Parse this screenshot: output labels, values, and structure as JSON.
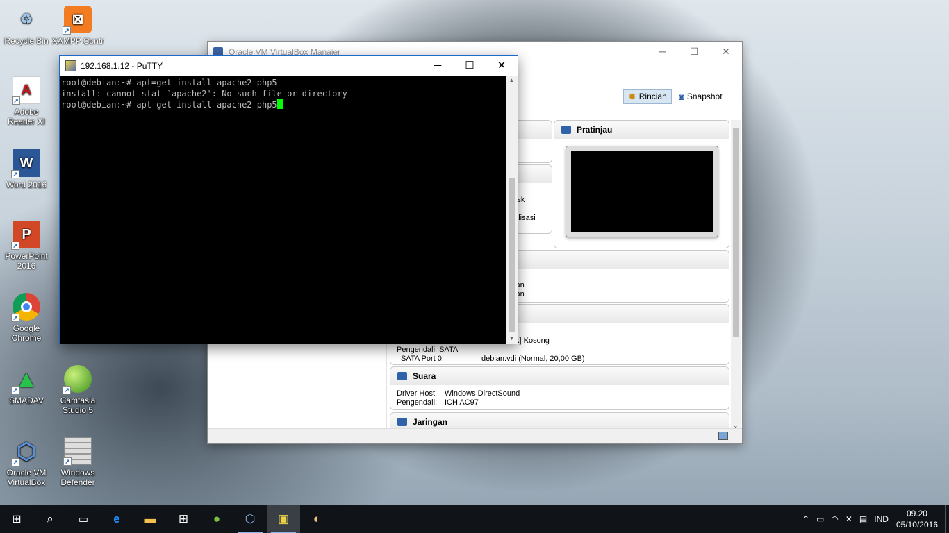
{
  "desktop_icons": [
    {
      "label": "Recycle Bin",
      "icon": "recycle-bin-icon"
    },
    {
      "label": "XAMPP Contr",
      "icon": "xampp-icon"
    },
    {
      "label": "Adobe Reader XI",
      "icon": "adobe-reader-icon"
    },
    {
      "label": "Word 2016",
      "icon": "word-icon"
    },
    {
      "label": "PowerPoint 2016",
      "icon": "powerpoint-icon"
    },
    {
      "label": "Google Chrome",
      "icon": "chrome-icon"
    },
    {
      "label": "SMADAV",
      "icon": "smadav-icon"
    },
    {
      "label": "Camtasia Studio 5",
      "icon": "camtasia-icon"
    },
    {
      "label": "Oracle VM VirtualBox",
      "icon": "virtualbox-icon"
    },
    {
      "label": "Windows Defender",
      "icon": "windows-defender-icon"
    }
  ],
  "vbox": {
    "title": "Oracle VM VirtualBox Manajer",
    "toolbar": {
      "details": "Rincian",
      "snapshot": "Snapshot"
    },
    "preview_title": "Pratinjau",
    "partial_text": {
      "disk": "Disk",
      "g": "g",
      "ualisasi": "ualisasi",
      "fkan1": "fkan",
      "fkan2": "fkan",
      "kosong": "k] Kosong"
    },
    "storage": {
      "controller_label": "Pengendali: SATA",
      "port_label": "SATA Port 0:",
      "port_value": "debian.vdi (Normal, 20,00 GB)"
    },
    "audio": {
      "title": "Suara",
      "host_label": "Driver Host:",
      "host_value": "Windows DirectSound",
      "controller_label": "Pengendali:",
      "controller_value": "ICH AC97"
    },
    "network": {
      "title": "Jaringan"
    }
  },
  "putty": {
    "title": "192.168.1.12 - PuTTY",
    "lines": [
      "root@debian:~# apt=get install apache2 php5",
      "install: cannot stat `apache2': No such file or directory",
      "root@debian:~# apt-get install apache2 php5"
    ]
  },
  "taskbar": {
    "items": [
      "start-icon",
      "search-icon",
      "task-view-icon",
      "edge-icon",
      "file-explorer-icon",
      "store-icon",
      "camtasia-icon",
      "virtualbox-icon",
      "putty-icon",
      "paint-icon"
    ],
    "language": "IND",
    "time": "09.20",
    "date": "05/10/2016"
  }
}
